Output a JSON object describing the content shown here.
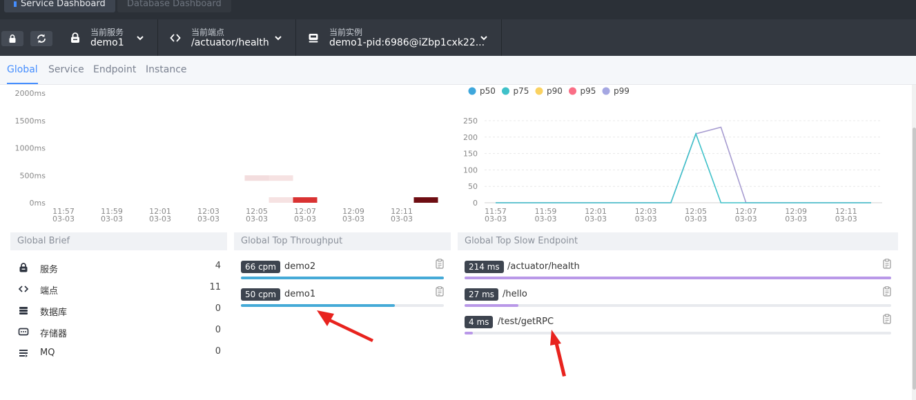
{
  "dashboards": {
    "active": "Service Dashboard",
    "inactive": "Database Dashboard"
  },
  "selectors": {
    "service": {
      "label": "当前服务",
      "value": "demo1"
    },
    "endpoint": {
      "label": "当前端点",
      "value": "/actuator/health"
    },
    "instance": {
      "label": "当前实例",
      "value": "demo1-pid:6986@iZbp1cxk22..."
    }
  },
  "nav": {
    "tabs": [
      "Global",
      "Service",
      "Endpoint",
      "Instance"
    ],
    "active": "Global"
  },
  "chart_data": [
    {
      "type": "heatmap",
      "y_ticks": [
        "0ms",
        "500ms",
        "1000ms",
        "1500ms",
        "2000ms"
      ],
      "x_ticks": [
        "11:57\n03-03",
        "11:59\n03-03",
        "12:01\n03-03",
        "12:03\n03-03",
        "12:05\n03-03",
        "12:07\n03-03",
        "12:09\n03-03",
        "12:11\n03-03"
      ],
      "ylim": [
        0,
        2000
      ],
      "cells": [
        {
          "x": "12:05",
          "y": 400,
          "intensity": 0.08
        },
        {
          "x": "12:06",
          "y": 400,
          "intensity": 0.06
        },
        {
          "x": "12:06",
          "y": 0,
          "intensity": 0.06
        },
        {
          "x": "12:07",
          "y": 0,
          "intensity": 0.8
        },
        {
          "x": "12:12",
          "y": 0,
          "intensity": 1.0
        }
      ]
    },
    {
      "type": "line",
      "legend": [
        "p50",
        "p75",
        "p90",
        "p95",
        "p99"
      ],
      "legend_colors": [
        "#3fa7dc",
        "#3fc1c9",
        "#fad261",
        "#fa6e86",
        "#a5a7e2"
      ],
      "legend_position": "top-left",
      "y_ticks": [
        0,
        50,
        100,
        150,
        200,
        250
      ],
      "ylim": [
        0,
        250
      ],
      "x_ticks": [
        "11:57\n03-03",
        "11:59\n03-03",
        "12:01\n03-03",
        "12:03\n03-03",
        "12:05\n03-03",
        "12:07\n03-03",
        "12:09\n03-03",
        "12:11\n03-03"
      ],
      "x": [
        "11:57",
        "11:58",
        "11:59",
        "12:00",
        "12:01",
        "12:02",
        "12:03",
        "12:04",
        "12:05",
        "12:06",
        "12:07",
        "12:08",
        "12:09",
        "12:10",
        "12:11",
        "12:12"
      ],
      "series": [
        {
          "name": "p75",
          "color": "#3fc1c9",
          "values": [
            0,
            0,
            0,
            0,
            0,
            0,
            0,
            0,
            210,
            0,
            0,
            0,
            0,
            0,
            0,
            0
          ]
        },
        {
          "name": "p99",
          "color": "#a69bd0",
          "values": [
            0,
            0,
            0,
            0,
            0,
            0,
            0,
            0,
            210,
            230,
            0,
            0,
            0,
            0,
            0,
            0
          ]
        }
      ]
    }
  ],
  "brief": {
    "title": "Global Brief",
    "items": [
      {
        "icon": "lock-icon",
        "label": "服务",
        "value": "4"
      },
      {
        "icon": "code-icon",
        "label": "端点",
        "value": "11"
      },
      {
        "icon": "database-icon",
        "label": "数据库",
        "value": "0"
      },
      {
        "icon": "storage-icon",
        "label": "存储器",
        "value": "0"
      },
      {
        "icon": "mq-icon",
        "label": "MQ",
        "value": "0"
      }
    ]
  },
  "throughput": {
    "title": "Global Top Throughput",
    "color": "#45aad7",
    "items": [
      {
        "badge": "66 cpm",
        "name": "demo2",
        "fraction": 1.0
      },
      {
        "badge": "50 cpm",
        "name": "demo1",
        "fraction": 0.76
      }
    ]
  },
  "slow": {
    "title": "Global Top Slow Endpoint",
    "color": "#b998e8",
    "items": [
      {
        "badge": "214 ms",
        "name": "/actuator/health",
        "fraction": 1.0
      },
      {
        "badge": "27 ms",
        "name": "/hello",
        "fraction": 0.126
      },
      {
        "badge": "4 ms",
        "name": "/test/getRPC",
        "fraction": 0.019
      }
    ]
  },
  "annotation_color": "#e8231e"
}
